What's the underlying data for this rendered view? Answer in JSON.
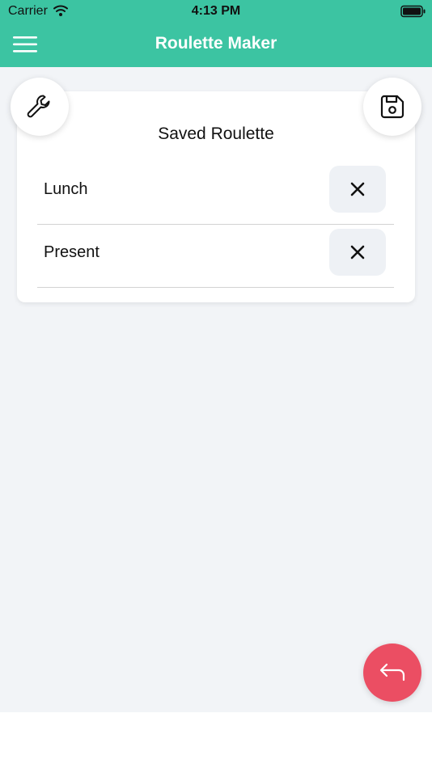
{
  "status_bar": {
    "carrier": "Carrier",
    "time": "4:13 PM",
    "icons": [
      "wifi-icon",
      "battery-icon"
    ]
  },
  "app_bar": {
    "title": "Roulette Maker",
    "menu_icon": "hamburger-menu-icon"
  },
  "card": {
    "title": "Saved Roulette",
    "items": [
      {
        "label": "Lunch",
        "delete_icon": "close-icon"
      },
      {
        "label": "Present",
        "delete_icon": "close-icon"
      }
    ]
  },
  "buttons": {
    "settings_icon": "wrench-icon",
    "save_icon": "save-icon",
    "back_icon": "undo-arrow-icon"
  },
  "colors": {
    "header": "#3cc4a2",
    "background": "#f2f4f7",
    "back_button": "#eb4e63",
    "delete_button_bg": "#eef1f5"
  }
}
